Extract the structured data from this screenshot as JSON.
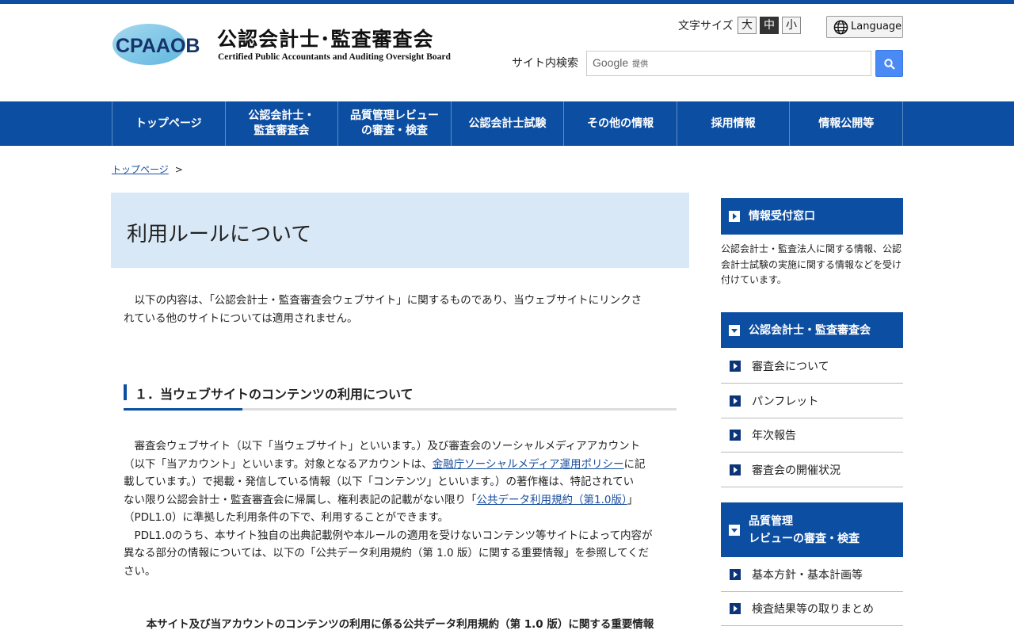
{
  "header": {
    "logo_mark_text": "CPAAOB",
    "org_name_ja": "公認会計士･監査審査会",
    "org_name_en": "Certified Public Accountants and Auditing Oversight Board",
    "font_size": {
      "label": "文字サイズ",
      "large": "大",
      "medium": "中",
      "small": "小",
      "selected": "中"
    },
    "language_label": "Language",
    "search": {
      "label": "サイト内検索",
      "google_text": "Google",
      "provided_text": "提供"
    }
  },
  "nav": {
    "items": [
      {
        "label": "トップページ"
      },
      {
        "label_line1": "公認会計士・",
        "label_line2": "監査審査会"
      },
      {
        "label_line1": "品質管理レビュー",
        "label_line2": "の審査・検査"
      },
      {
        "label": "公認会計士試験"
      },
      {
        "label": "その他の情報"
      },
      {
        "label": "採用情報"
      },
      {
        "label": "情報公開等"
      }
    ]
  },
  "breadcrumb": {
    "home": "トップページ",
    "separator": ">"
  },
  "main": {
    "title": "利用ルールについて",
    "intro_line1": "　以下の内容は、「公認会計士・監査審査会ウェブサイト」に関するものであり、当ウェブサイトにリンクさ",
    "intro_line2": "れている他のサイトについては適用されません。",
    "section1_heading": "１．当ウェブサイトのコンテンツの利用について",
    "body": {
      "l1": "　審査会ウェブサイト（以下「当ウェブサイト」といいます。）及び審査会のソーシャルメディアアカウント",
      "l2a": "（以下「当アカウント」といいます。対象となるアカウントは、",
      "l2_link": "金融庁ソーシャルメディア運用ポリシー",
      "l2b": "に記",
      "l3": "載しています。）で掲載・発信している情報（以下「コンテンツ」といいます。）の著作権は、特記されてい",
      "l4a": "ない限り公認会計士・監査審査会に帰属し、権利表記の記載がない限り「",
      "l4_link": "公共データ利用規約（第1.0版）",
      "l4b": "」",
      "l5": "（PDL1.0）に準拠した利用条件の下で、利用することができます。",
      "l6": "　PDL1.0のうち、本サイト独自の出典記載例や本ルールの適用を受けないコンテンツ等サイトによって内容が",
      "l7": "異なる部分の情報については、以下の「公共データ利用規約（第 1.0 版）に関する重要情報」を参照してくだ",
      "l8": "さい。"
    },
    "subheading": "本サイト及び当アカウントのコンテンツの利用に係る公共データ利用規約（第 1.0 版）に関する重要情報"
  },
  "sidebar": {
    "info_window": {
      "title": "情報受付窓口",
      "note": "公認会計士・監査法人に関する情報、公認会計士試験の実施に関する情報などを受け付けています。"
    },
    "section1": {
      "title": "公認会計士・監査審査会",
      "items": [
        "審査会について",
        "パンフレット",
        "年次報告",
        "審査会の開催状況"
      ]
    },
    "section2": {
      "title_line1": "品質管理",
      "title_line2": "レビューの審査・検査",
      "items": [
        "基本方針・基本計画等",
        "検査結果等の取りまとめ"
      ]
    }
  },
  "colors": {
    "primary_blue": "#0c4ea2",
    "title_bg": "#d9e8f6",
    "link": "#1a4fa0"
  }
}
